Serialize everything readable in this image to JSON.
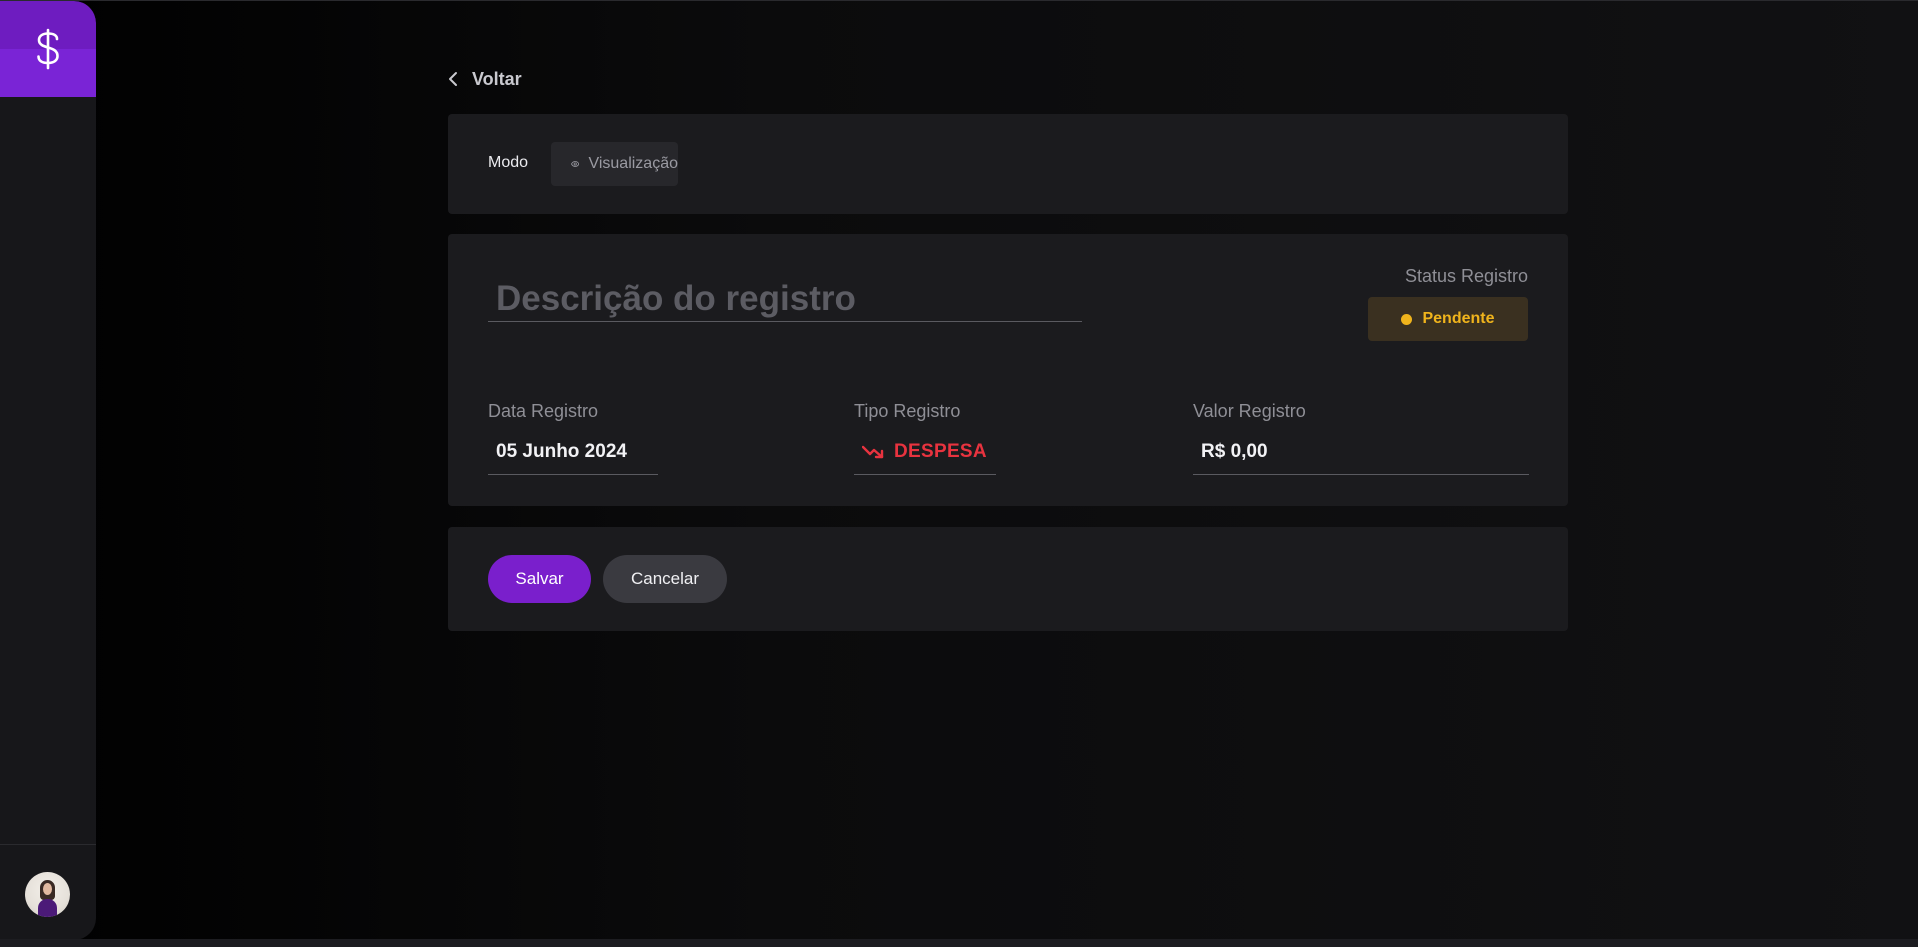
{
  "sidebar": {
    "logo_icon": "dollar-sign-icon",
    "accent_color": "#7a24d6",
    "avatar_icon": "user-avatar"
  },
  "header": {
    "back_label": "Voltar",
    "back_icon": "chevron-left-icon"
  },
  "mode": {
    "label": "Modo",
    "value": "Visualização",
    "icon": "eye-icon"
  },
  "form": {
    "description_placeholder": "Descrição do registro",
    "description_value": "",
    "status": {
      "title": "Status Registro",
      "value": "Pendente",
      "color": "#f0b41c"
    },
    "date": {
      "label": "Data Registro",
      "value": "05 Junho 2024"
    },
    "type": {
      "label": "Tipo Registro",
      "value": "DESPESA",
      "icon": "trending-down-icon",
      "color": "#e8333f"
    },
    "amount": {
      "label": "Valor Registro",
      "value": "R$ 0,00"
    }
  },
  "actions": {
    "save_label": "Salvar",
    "cancel_label": "Cancelar",
    "save_color": "#7a1fcc"
  }
}
